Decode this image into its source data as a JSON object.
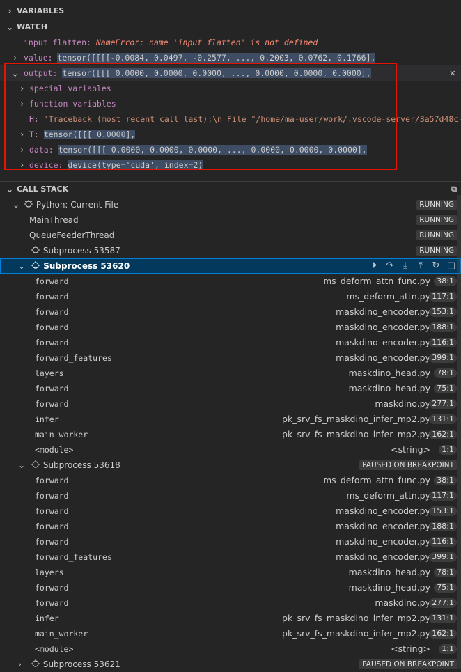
{
  "variables": {
    "title": "VARIABLES"
  },
  "watch": {
    "title": "WATCH",
    "rows": [
      {
        "name": "input_flatten:",
        "value": "NameError: name 'input_flatten' is not defined"
      },
      {
        "name": "value:",
        "value": "tensor([[[[-0.0084,  0.0497, -0.2577,  ...,  0.2003,  0.0762,  0.1766],"
      },
      {
        "name": "output:",
        "value": "tensor([[[ 0.0000,  0.0000,  0.0000,  ...,  0.0000,  0.0000,  0.0000],"
      }
    ],
    "children": [
      {
        "label": "special variables"
      },
      {
        "label": "function variables"
      },
      {
        "name": "H:",
        "value": "'Traceback (most recent call last):\\n  File \"/home/ma-user/work/.vscode-server/3a57d48c-8c1..."
      },
      {
        "name": "T:",
        "value": "tensor([[[ 0.0000],"
      },
      {
        "name": "data:",
        "value": "tensor([[[ 0.0000,  0.0000,  0.0000,  ...,  0.0000,  0.0000,  0.0000],"
      },
      {
        "name": "device:",
        "value": "device(type='cuda', index=2)"
      }
    ],
    "close_icon": "close-icon"
  },
  "callstack": {
    "title": "CALL STACK",
    "session": {
      "label": "Python: Current File",
      "status": "RUNNING"
    },
    "threads": [
      {
        "label": "MainThread",
        "status": "RUNNING"
      },
      {
        "label": "QueueFeederThread",
        "status": "RUNNING"
      }
    ],
    "sub53587": {
      "label": "Subprocess 53587",
      "status": "RUNNING"
    },
    "sub53620": {
      "label": "Subprocess 53620"
    },
    "frames1": [
      {
        "name": "forward",
        "file": "ms_deform_attn_func.py",
        "line": "38:1"
      },
      {
        "name": "forward",
        "file": "ms_deform_attn.py",
        "line": "117:1"
      },
      {
        "name": "forward",
        "file": "maskdino_encoder.py",
        "line": "153:1"
      },
      {
        "name": "forward",
        "file": "maskdino_encoder.py",
        "line": "188:1"
      },
      {
        "name": "forward",
        "file": "maskdino_encoder.py",
        "line": "116:1"
      },
      {
        "name": "forward_features",
        "file": "maskdino_encoder.py",
        "line": "399:1"
      },
      {
        "name": "layers",
        "file": "maskdino_head.py",
        "line": "78:1"
      },
      {
        "name": "forward",
        "file": "maskdino_head.py",
        "line": "75:1"
      },
      {
        "name": "forward",
        "file": "maskdino.py",
        "line": "277:1"
      },
      {
        "name": "infer",
        "file": "pk_srv_fs_maskdino_infer_mp2.py",
        "line": "131:1"
      },
      {
        "name": "main_worker",
        "file": "pk_srv_fs_maskdino_infer_mp2.py",
        "line": "162:1"
      },
      {
        "name": "<module>",
        "file": "<string>",
        "line": "1:1"
      }
    ],
    "sub53618": {
      "label": "Subprocess 53618",
      "status": "PAUSED ON BREAKPOINT"
    },
    "frames2": [
      {
        "name": "forward",
        "file": "ms_deform_attn_func.py",
        "line": "38:1"
      },
      {
        "name": "forward",
        "file": "ms_deform_attn.py",
        "line": "117:1"
      },
      {
        "name": "forward",
        "file": "maskdino_encoder.py",
        "line": "153:1"
      },
      {
        "name": "forward",
        "file": "maskdino_encoder.py",
        "line": "188:1"
      },
      {
        "name": "forward",
        "file": "maskdino_encoder.py",
        "line": "116:1"
      },
      {
        "name": "forward_features",
        "file": "maskdino_encoder.py",
        "line": "399:1"
      },
      {
        "name": "layers",
        "file": "maskdino_head.py",
        "line": "78:1"
      },
      {
        "name": "forward",
        "file": "maskdino_head.py",
        "line": "75:1"
      },
      {
        "name": "forward",
        "file": "maskdino.py",
        "line": "277:1"
      },
      {
        "name": "infer",
        "file": "pk_srv_fs_maskdino_infer_mp2.py",
        "line": "131:1"
      },
      {
        "name": "main_worker",
        "file": "pk_srv_fs_maskdino_infer_mp2.py",
        "line": "162:1"
      },
      {
        "name": "<module>",
        "file": "<string>",
        "line": "1:1"
      }
    ],
    "sub53621": {
      "label": "Subprocess 53621",
      "status": "PAUSED ON BREAKPOINT"
    }
  }
}
